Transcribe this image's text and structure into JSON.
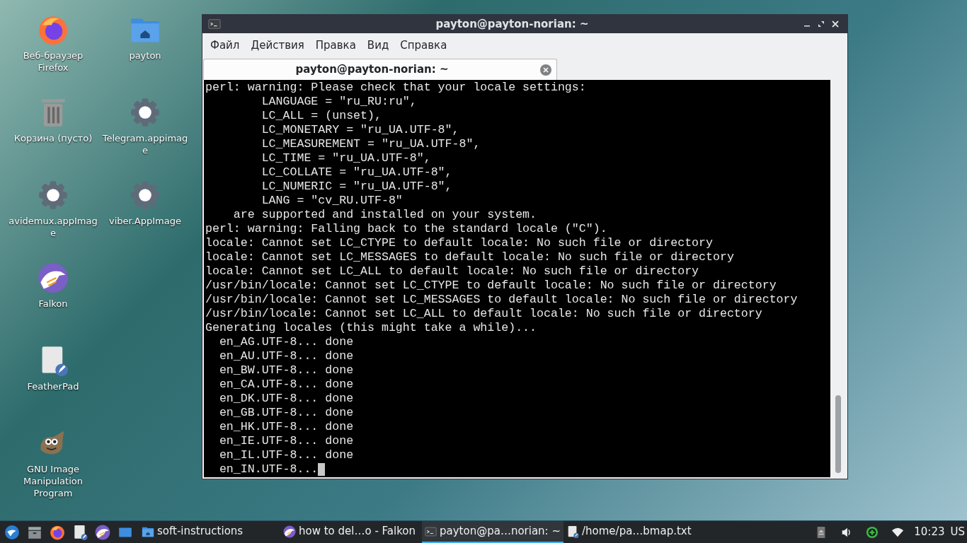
{
  "desktop": {
    "columns": [
      [
        {
          "label": "Веб-браузер Firefox",
          "kind": "firefox"
        },
        {
          "label": "Корзина (пусто)",
          "kind": "trash"
        },
        {
          "label": "avidemux.appImage",
          "kind": "gear"
        },
        {
          "label": "Falkon",
          "kind": "falkon"
        },
        {
          "label": "FeatherPad",
          "kind": "featherpad"
        },
        {
          "label": "GNU Image Manipulation Program",
          "kind": "gimp"
        }
      ],
      [
        {
          "label": "payton",
          "kind": "folder"
        },
        {
          "label": "Telegram.appimage",
          "kind": "gear"
        },
        {
          "label": "viber.AppImage",
          "kind": "gear"
        }
      ]
    ]
  },
  "window": {
    "title": "payton@payton-norian: ~",
    "menu": [
      "Файл",
      "Действия",
      "Правка",
      "Вид",
      "Справка"
    ],
    "tabs": [
      {
        "label": "payton@payton-norian: ~",
        "selected": true
      }
    ],
    "terminal": {
      "cursor_visible": true,
      "lines": [
        "perl: warning: Please check that your locale settings:",
        "        LANGUAGE = \"ru_RU:ru\",",
        "        LC_ALL = (unset),",
        "        LC_MONETARY = \"ru_UA.UTF-8\",",
        "        LC_MEASUREMENT = \"ru_UA.UTF-8\",",
        "        LC_TIME = \"ru_UA.UTF-8\",",
        "        LC_COLLATE = \"ru_UA.UTF-8\",",
        "        LC_NUMERIC = \"ru_UA.UTF-8\",",
        "        LANG = \"cv_RU.UTF-8\"",
        "    are supported and installed on your system.",
        "perl: warning: Falling back to the standard locale (\"C\").",
        "locale: Cannot set LC_CTYPE to default locale: No such file or directory",
        "locale: Cannot set LC_MESSAGES to default locale: No such file or directory",
        "locale: Cannot set LC_ALL to default locale: No such file or directory",
        "/usr/bin/locale: Cannot set LC_CTYPE to default locale: No such file or directory",
        "/usr/bin/locale: Cannot set LC_MESSAGES to default locale: No such file or directory",
        "/usr/bin/locale: Cannot set LC_ALL to default locale: No such file or directory",
        "Generating locales (this might take a while)...",
        "  en_AG.UTF-8... done",
        "  en_AU.UTF-8... done",
        "  en_BW.UTF-8... done",
        "  en_CA.UTF-8... done",
        "  en_DK.UTF-8... done",
        "  en_GB.UTF-8... done",
        "  en_HK.UTF-8... done",
        "  en_IE.UTF-8... done",
        "  en_IL.UTF-8... done",
        "  en_IN.UTF-8..."
      ]
    }
  },
  "taskbar": {
    "launchers": [
      {
        "kind": "start"
      },
      {
        "kind": "files"
      },
      {
        "kind": "firefox"
      },
      {
        "kind": "featherpad"
      },
      {
        "kind": "falkon"
      },
      {
        "kind": "desktop"
      }
    ],
    "tasks": [
      {
        "label": "soft-instructions",
        "kind": "folder",
        "selected": false
      },
      {
        "label": "how to del…o - Falkon",
        "kind": "falkon",
        "selected": false
      },
      {
        "label": "payton@pa…norian: ~",
        "kind": "terminal",
        "selected": true
      },
      {
        "label": "/home/pa…bmap.txt",
        "kind": "featherpad",
        "selected": false
      }
    ],
    "tray": [
      {
        "kind": "eject"
      },
      {
        "kind": "volume"
      },
      {
        "kind": "update"
      },
      {
        "kind": "wifi"
      }
    ],
    "clock": "10:23",
    "layout": "US"
  }
}
